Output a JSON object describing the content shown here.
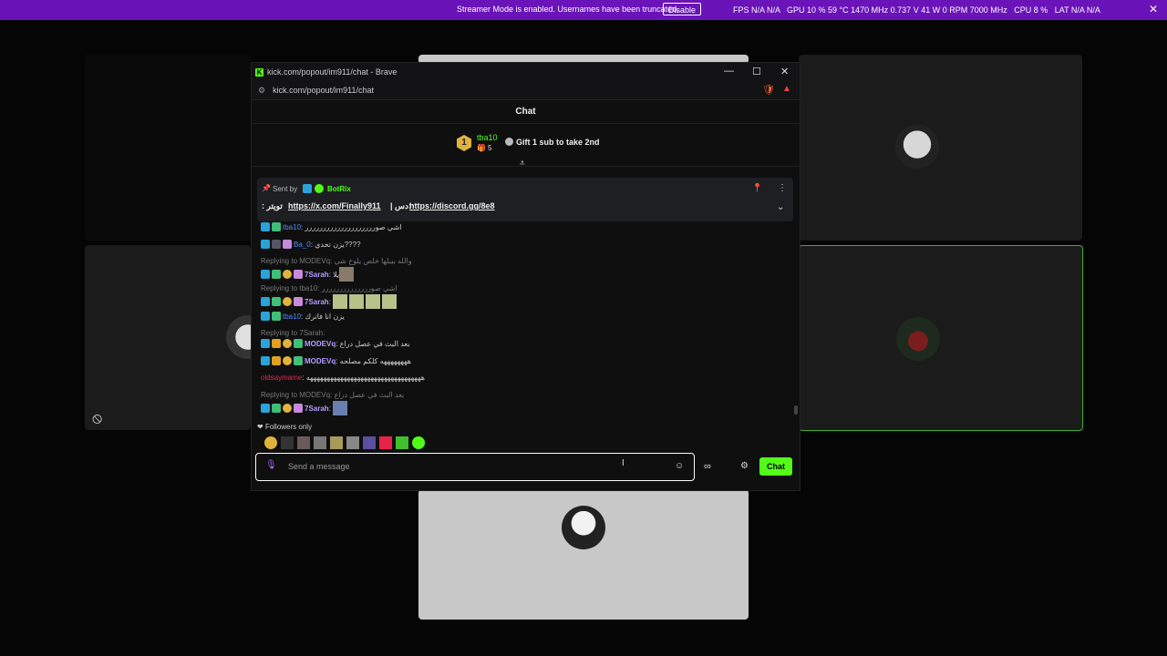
{
  "topbar": {
    "notice": "Streamer Mode is enabled. Usernames have been truncated.",
    "disable_label": "Disable",
    "stats": "FPS N/A N/A   GPU 10 % 59 °C 1470 MHz 0.737 V 41 W 0 RPM 7000 MHz   CPU 8 %   LAT N/A N/A"
  },
  "browser": {
    "title": "kick.com/popout/im911/chat - Brave",
    "url": "kick.com/popout/im911/chat"
  },
  "chat": {
    "header": "Chat",
    "goal_user": "tba10",
    "goal_count": "5",
    "goal_rank": "1",
    "gift_text": "Gift 1 sub to take 2nd",
    "pinned_sent_by": "Sent by",
    "pinned_user": "BotRix",
    "pinned_text_prefix": ": تويتر",
    "pinned_link1": "https://x.com/Finally911",
    "pinned_sep": "| دس:",
    "pinned_link2": "https://discord.gg/8e8",
    "followers_only": "Followers only",
    "input_placeholder": "Send a message",
    "send_label": "Chat",
    "messages": [
      {
        "user": "tba10",
        "color": "#4d8dff",
        "text": ": اشي صورررررررررررررررررررر",
        "reply": ""
      },
      {
        "user": "Ba_0",
        "color": "#4d8dff",
        "text": ": يزن تحدي????",
        "reply": ""
      },
      {
        "user": "7Sarah",
        "color": "#b59cff",
        "text": ": يلا",
        "reply": "Replying to MODEVq: والله بيبلها خلص يلوخ شي"
      },
      {
        "user": "7Sarah",
        "color": "#b59cff",
        "text": ":",
        "reply": "Replying to tba10: اشي صورررررررررررررر"
      },
      {
        "user": "tba10",
        "color": "#4d8dff",
        "text": ": يزن انا فاترك",
        "reply": ""
      },
      {
        "user": "MODEVq",
        "color": "#b59cff",
        "text": ": بعد البث في عصل دراع",
        "reply": "Replying to 7Sarah:"
      },
      {
        "user": "MODEVq",
        "color": "#b59cff",
        "text": ": ههههههههه كلكم مصلحه",
        "reply": ""
      },
      {
        "user": "oldsaymame",
        "color": "#e8234a",
        "text": ": ههههههههههههههههههههههههههههههههههه",
        "reply": ""
      },
      {
        "user": "7Sarah",
        "color": "#b59cff",
        "text": ":",
        "reply": "Replying to MODEVq: بعد البث في عصل دراع"
      }
    ]
  },
  "colors": {
    "accent": "#53fc18",
    "purple": "#6a13b8"
  }
}
